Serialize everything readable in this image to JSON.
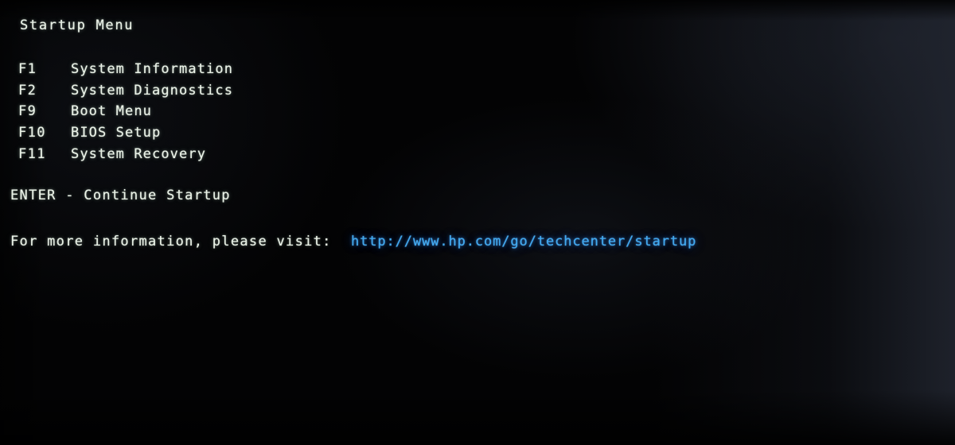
{
  "screen": {
    "title": "Startup Menu",
    "background_color": "#030304",
    "text_color": "#e9f1e6",
    "link_color": "#3fa9f0"
  },
  "menu": {
    "items": [
      {
        "key": "F1",
        "label": "System Information"
      },
      {
        "key": "F2",
        "label": "System Diagnostics"
      },
      {
        "key": "F9",
        "label": "Boot Menu"
      },
      {
        "key": "F10",
        "label": "BIOS Setup"
      },
      {
        "key": "F11",
        "label": "System Recovery"
      }
    ]
  },
  "continue_line": "ENTER - Continue Startup",
  "info": {
    "prefix": "For more information, please visit:",
    "url": "http://www.hp.com/go/techcenter/startup"
  }
}
